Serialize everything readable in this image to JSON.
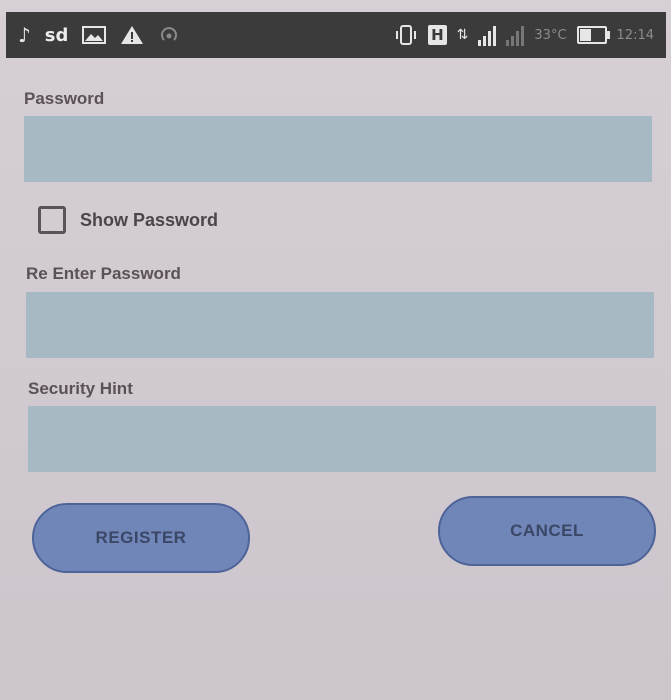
{
  "status_bar": {
    "left_icons": [
      "music-note-icon",
      "sd-card-icon",
      "image-icon",
      "warning-icon",
      "hotspot-icon"
    ],
    "sd_text": "sd",
    "network_type": "H",
    "temperature": "33°C",
    "time": "12:14",
    "battery_level": 0.5
  },
  "form": {
    "password_label": "Password",
    "password_value": "",
    "show_password_label": "Show Password",
    "show_password_checked": false,
    "reenter_label": "Re Enter Password",
    "reenter_value": "",
    "hint_label": "Security Hint",
    "hint_value": ""
  },
  "buttons": {
    "register": "REGISTER",
    "cancel": "CANCEL"
  },
  "colors": {
    "background": "#cfc8ce",
    "field": "#a7bac4",
    "button": "#7186b8",
    "status_bar": "#3b3b3b"
  }
}
